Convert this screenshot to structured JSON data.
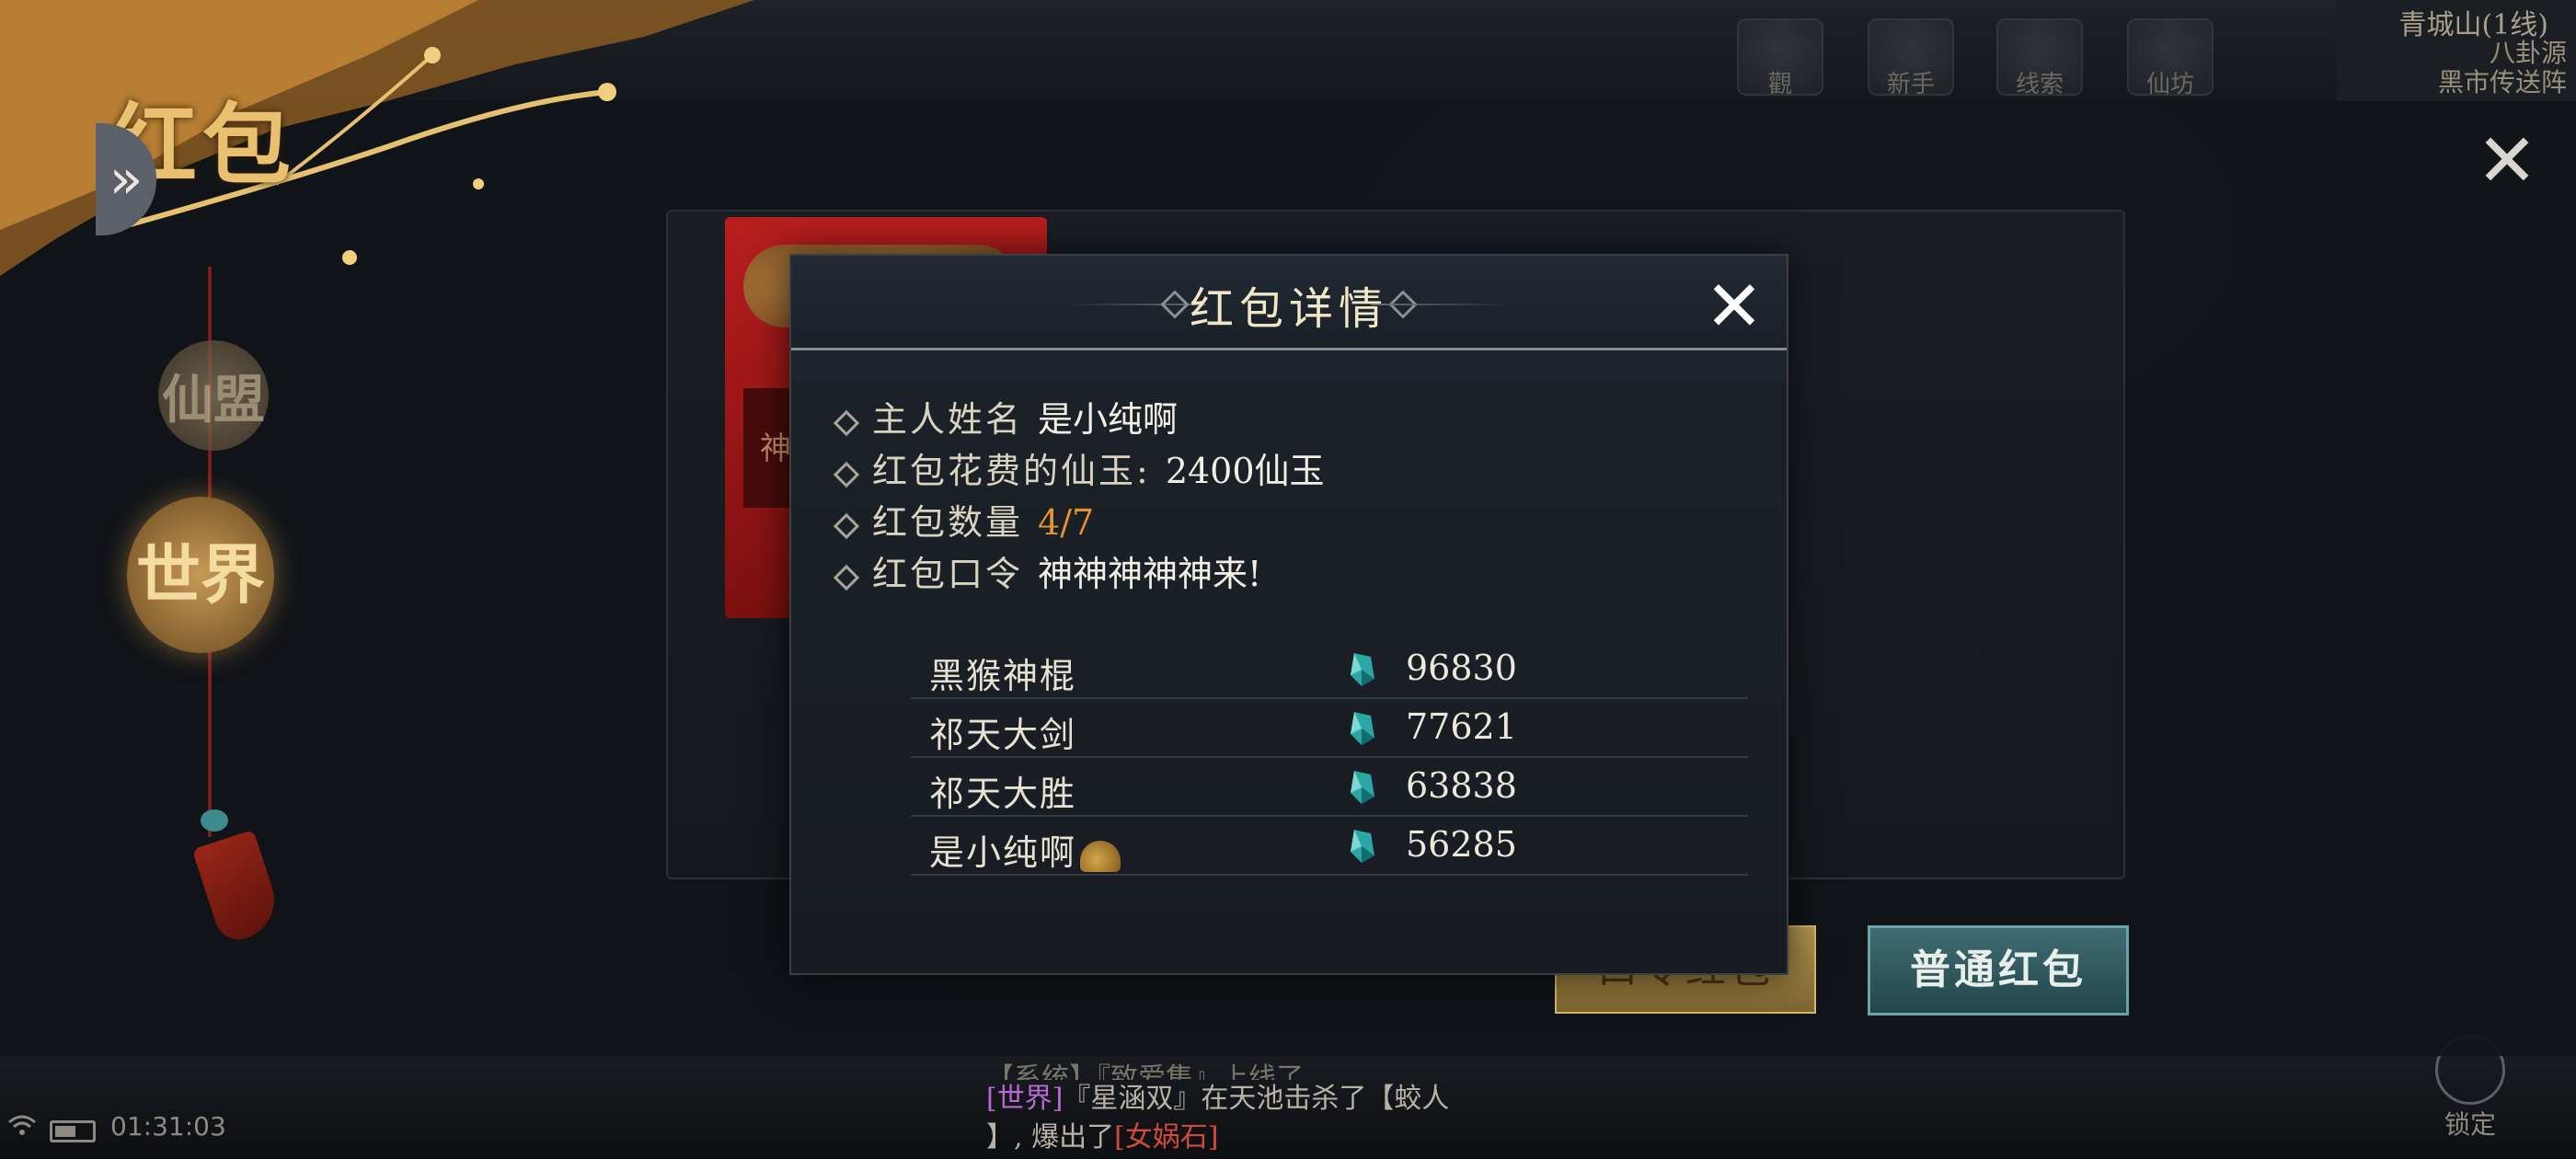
{
  "top_icons": [
    {
      "icon": "eye-icon",
      "label": "觀"
    },
    {
      "icon": "tripod-icon",
      "label": "新手"
    },
    {
      "icon": "book-icon",
      "label": "线索"
    },
    {
      "icon": "pavilion-icon",
      "label": "仙坊"
    }
  ],
  "map_info": {
    "location": "青城山(1线)",
    "line2": "八卦源",
    "line3": "黑市传送阵"
  },
  "window": {
    "title": "红包",
    "close_symbol": "✕",
    "collapse_symbol": "»",
    "channels": [
      {
        "label": "仙盟",
        "active": false
      },
      {
        "label": "世界",
        "active": true
      }
    ],
    "envelope_label": "神",
    "password_button": "口令红包",
    "normal_button": "普通红包"
  },
  "modal": {
    "title": "红包详情",
    "close_symbol": "✕",
    "info": [
      {
        "label": "主人姓名",
        "value": "是小纯啊",
        "style": "normal"
      },
      {
        "label": "红包花费的仙玉:",
        "value": "2400仙玉",
        "style": "normal"
      },
      {
        "label": "红包数量",
        "value": "4/7",
        "style": "count"
      },
      {
        "label": "红包口令",
        "value": "神神神神神来!",
        "style": "normal"
      }
    ],
    "receivers": [
      {
        "name": "黑猴神棍",
        "amount": "96830",
        "icon": "jade-gem-icon"
      },
      {
        "name": "祁天大剑",
        "amount": "77621",
        "icon": "jade-gem-icon"
      },
      {
        "name": "祁天大胜",
        "amount": "63838",
        "icon": "jade-gem-icon"
      },
      {
        "name": "是小纯啊",
        "amount": "56285",
        "icon": "jade-gem-icon",
        "badge": "helmet-icon"
      }
    ]
  },
  "status": {
    "time": "01:31:03"
  },
  "chat": {
    "line1": "【系统】『致爱集』上线了",
    "channel": "[世界]",
    "line2_pre": "『星涵双』在天池击杀了【蛟人",
    "line3_pre": "】, 爆出了",
    "item": "[女娲石]"
  },
  "lock_label": "锁定",
  "colors": {
    "accent_gold": "#e8c070",
    "count_orange": "#e6922e",
    "envelope_red": "#b81e1e",
    "normal_button_teal": "#3f6d73"
  }
}
